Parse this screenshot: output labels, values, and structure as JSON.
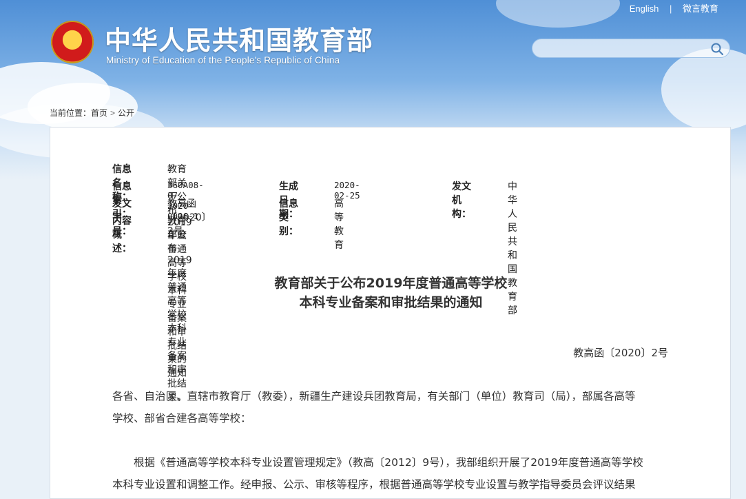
{
  "header": {
    "site_title": "中华人民共和国教育部",
    "site_subtitle": "Ministry of Education of the People's Republic of China",
    "top_links": [
      "English",
      "微言教育"
    ],
    "search": {
      "placeholder": "",
      "icon": "search-icon"
    },
    "emblem_icon": "national-emblem-icon"
  },
  "breadcrumb": {
    "prefix": "当前位置：",
    "items": [
      "首页",
      "公开"
    ],
    "separator": ">"
  },
  "metadata": {
    "name_label": "信息名称：",
    "name_value": "教育部关于公布2019年度普通高等学校本科专业备案和审批结果的通知",
    "index_label": "信息索引：",
    "index_value": "360A08-07-2020-0006-1",
    "date_label": "生成日期：",
    "date_value": "2020-02-25",
    "org_label": "发文机构：",
    "org_value": "中华人民共和国教育部",
    "docno_label": "发文字号：",
    "docno_value": "教高函〔2020〕2号",
    "category_label": "信息类别：",
    "category_value": "高等教育",
    "summary_label": "内容概述：",
    "summary_value": "教育部公布2019年度普通高等学校本科专业备案和审批结果。"
  },
  "document": {
    "title_line1": "教育部关于公布2019年度普通高等学校",
    "title_line2": "本科专业备案和审批结果的通知",
    "number": "教高函〔2020〕2号",
    "salutation_line1": "各省、自治区、直辖市教育厅（教委），新疆生产建设兵团教育局，有关部门（单位）教育司（局），部属各高等",
    "salutation_line2": "学校、部省合建各高等学校：",
    "body_line1": "根据《普通高等学校本科专业设置管理规定》（教高〔2012〕9号），我部组织开展了2019年度普通高等学校",
    "body_line2": "本科专业设置和调整工作。经申报、公示、审核等程序，根据普通高等学校专业设置与教学指导委员会评议结果"
  },
  "colors": {
    "sky_top": "#4f8fd6",
    "panel_bg": "#ffffff",
    "text": "#333333"
  }
}
